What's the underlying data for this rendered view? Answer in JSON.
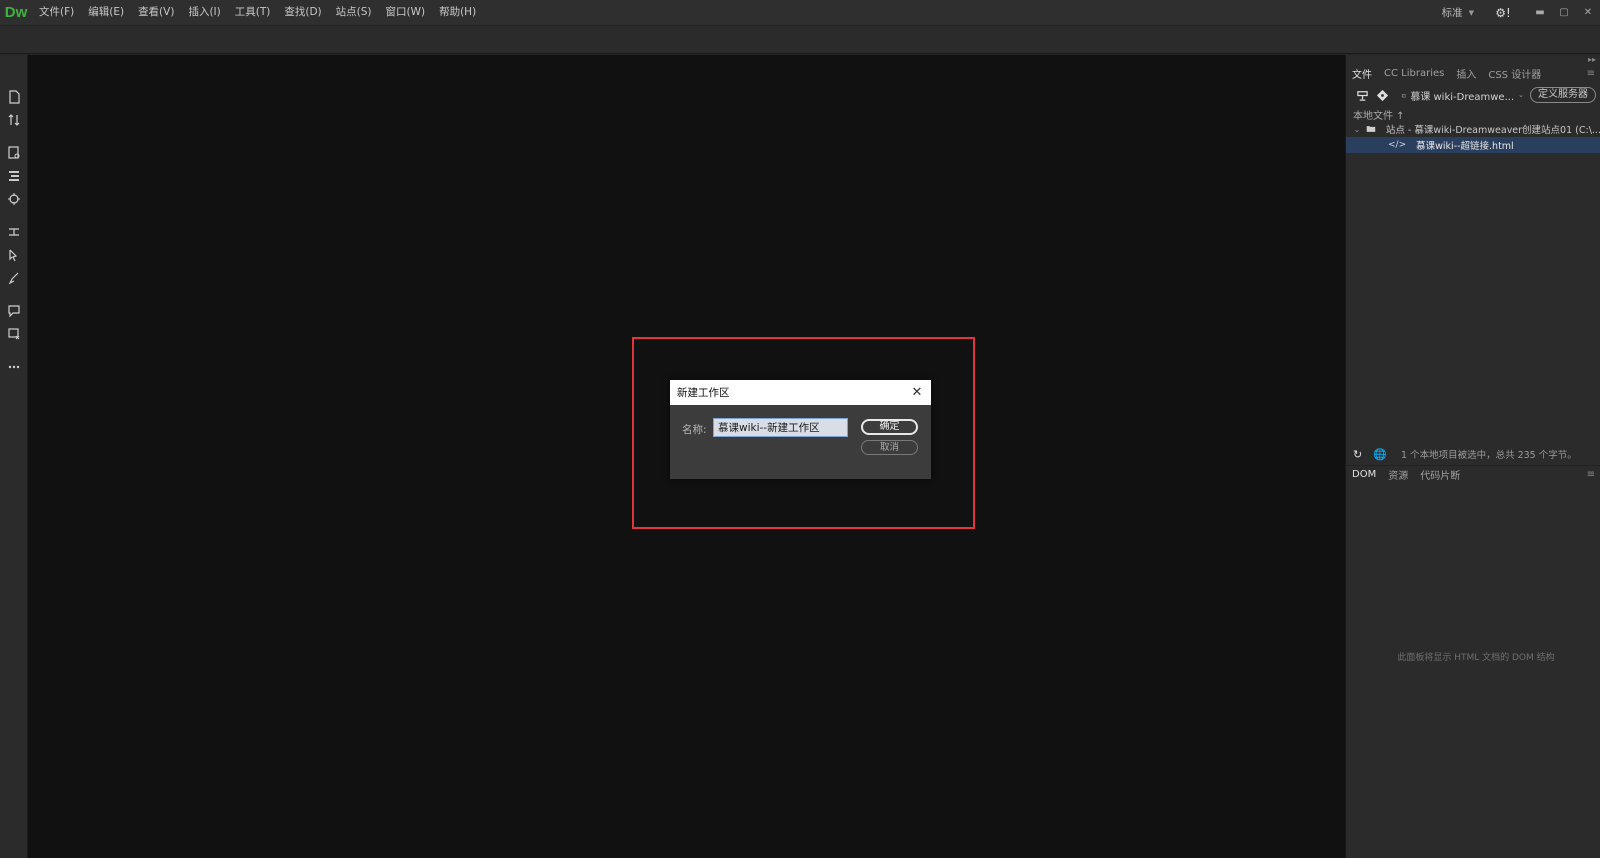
{
  "app": {
    "logo": "Dw"
  },
  "menu": [
    "文件(F)",
    "编辑(E)",
    "查看(V)",
    "插入(I)",
    "工具(T)",
    "查找(D)",
    "站点(S)",
    "窗口(W)",
    "帮助(H)"
  ],
  "workspace": {
    "label": "标准"
  },
  "dialog": {
    "title": "新建工作区",
    "name_label": "名称:",
    "name_value": "慕课wiki--新建工作区",
    "ok_label": "确定",
    "cancel_label": "取消"
  },
  "files_panel": {
    "tabs": [
      "文件",
      "CC Libraries",
      "插入",
      "CSS 设计器"
    ],
    "site_select": "慕课 wiki-Dreamwe...",
    "server_button": "定义服务器",
    "local_files_label": "本地文件 ↑",
    "tree": [
      {
        "label": "站点 - 慕课wiki-Dreamweaver创建站点01 (C:\\...",
        "type": "site"
      },
      {
        "label": "慕课wiki--超链接.html",
        "type": "file"
      }
    ],
    "status": "1 个本地项目被选中，总共 235 个字节。"
  },
  "dom_panel": {
    "tabs": [
      "DOM",
      "资源",
      "代码片断"
    ],
    "message": "此面板将显示 HTML 文档的 DOM 结构"
  },
  "colors": {
    "highlight": "#e0353a",
    "logo": "#3fb33f",
    "selection": "#2a3f5e"
  }
}
